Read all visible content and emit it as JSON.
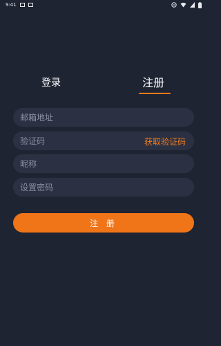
{
  "status_bar": {
    "time": "9:41"
  },
  "tabs": {
    "login": "登录",
    "register": "注册"
  },
  "form": {
    "email_placeholder": "邮箱地址",
    "code_placeholder": "验证码",
    "get_code_label": "获取验证码",
    "nickname_placeholder": "昵称",
    "password_placeholder": "设置密码",
    "submit_label": "注 册"
  },
  "colors": {
    "background": "#1f2433",
    "field_background": "#2b3142",
    "accent": "#f07418"
  }
}
